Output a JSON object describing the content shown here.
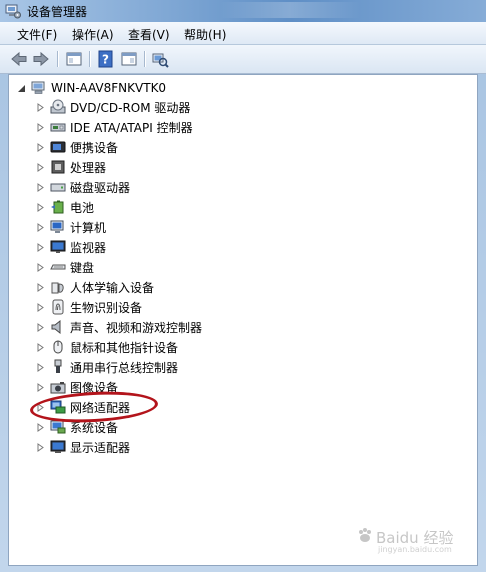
{
  "window": {
    "title": "设备管理器"
  },
  "menu": [
    {
      "label": "文件(F)"
    },
    {
      "label": "操作(A)"
    },
    {
      "label": "查看(V)"
    },
    {
      "label": "帮助(H)"
    }
  ],
  "toolbar": {
    "buttons": [
      {
        "icon": "back-arrow-icon"
      },
      {
        "icon": "forward-arrow-icon"
      },
      {
        "icon": "properties-window-icon"
      },
      {
        "icon": "help-icon"
      },
      {
        "icon": "update-driver-window-icon"
      },
      {
        "icon": "scan-hardware-icon"
      }
    ]
  },
  "tree": {
    "root": {
      "label": "WIN-AAV8FNKVTK0",
      "icon": "computer-icon"
    },
    "items": [
      {
        "label": "DVD/CD-ROM 驱动器",
        "icon": "dvd-drive-icon"
      },
      {
        "label": "IDE ATA/ATAPI 控制器",
        "icon": "ide-controller-icon"
      },
      {
        "label": "便携设备",
        "icon": "portable-device-icon"
      },
      {
        "label": "处理器",
        "icon": "processor-icon"
      },
      {
        "label": "磁盘驱动器",
        "icon": "disk-drive-icon"
      },
      {
        "label": "电池",
        "icon": "battery-icon"
      },
      {
        "label": "计算机",
        "icon": "computer-monitor-icon"
      },
      {
        "label": "监视器",
        "icon": "monitor-icon"
      },
      {
        "label": "键盘",
        "icon": "keyboard-icon"
      },
      {
        "label": "人体学输入设备",
        "icon": "hid-icon"
      },
      {
        "label": "生物识别设备",
        "icon": "fingerprint-icon"
      },
      {
        "label": "声音、视频和游戏控制器",
        "icon": "speaker-icon"
      },
      {
        "label": "鼠标和其他指针设备",
        "icon": "mouse-icon"
      },
      {
        "label": "通用串行总线控制器",
        "icon": "usb-icon"
      },
      {
        "label": "图像设备",
        "icon": "camera-icon"
      },
      {
        "label": "网络适配器",
        "icon": "network-adapter-icon"
      },
      {
        "label": "系统设备",
        "icon": "system-device-icon"
      },
      {
        "label": "显示适配器",
        "icon": "display-adapter-icon"
      }
    ]
  },
  "watermark": {
    "text": "Baidu 经验",
    "sub": "jingyan.baidu.com"
  },
  "colors": {
    "annotation_ellipse": "#b3141b",
    "selection_blue": "#3a6fb7"
  }
}
